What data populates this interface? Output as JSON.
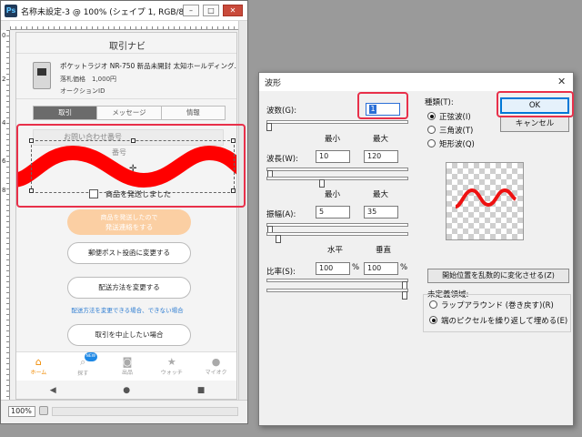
{
  "doc_window": {
    "title": "名称未設定-3 @ 100% (シェイプ 1, RGB/8)",
    "app_icon": "Ps",
    "minimize_icon": "minimize-icon",
    "maximize_icon": "maximize-icon",
    "close_icon": "close-icon",
    "ruler_v_numbers": [
      "0",
      "2",
      "4",
      "6",
      "8"
    ],
    "zoom": "100%"
  },
  "app": {
    "nav_title": "取引ナビ",
    "product": {
      "title": "ポケットラジオ NR-750 新品未開封 太知ホールディング...",
      "price": "落札価格　1,000円",
      "type": "オークションID"
    },
    "tabs": [
      {
        "label": "取引",
        "active": true
      },
      {
        "label": "メッセージ",
        "active": false
      },
      {
        "label": "情報",
        "active": false
      }
    ],
    "tracking": {
      "label": "お問い合わせ番号",
      "label2": "番号"
    },
    "shipped_checkbox_label": "商品を発送しました",
    "notice_button": {
      "line1": "商品を発送したので",
      "line2": "発送連絡をする"
    },
    "buttons": {
      "post": "郵便ポスト投函に変更する",
      "change_ship": "配送方法を変更する",
      "cancel_trade": "取引を中止したい場合"
    },
    "ship_note": "配送方法を変更できる場合、できない場合",
    "tabbar": [
      {
        "label": "ホーム",
        "icon": "home-icon",
        "glyph": "⌂",
        "active": true
      },
      {
        "label": "探す",
        "icon": "search-icon",
        "glyph": "⌕",
        "active": false,
        "badge": "NEW"
      },
      {
        "label": "出品",
        "icon": "camera-icon",
        "glyph": "◙",
        "active": false
      },
      {
        "label": "ウォッチ",
        "icon": "star-icon",
        "glyph": "★",
        "active": false
      },
      {
        "label": "マイオク",
        "icon": "person-icon",
        "glyph": "●",
        "active": false
      }
    ],
    "sysbar": {
      "back": "◀",
      "home": "●",
      "recent": "■"
    },
    "wave_color": "#ff0000"
  },
  "dialog": {
    "title": "波形",
    "close_glyph": "✕",
    "generators_label": "波数(G):",
    "generators_value": "1",
    "min_label": "最小",
    "max_label": "最大",
    "wavelength": {
      "label": "波長(W):",
      "min": "10",
      "max": "120"
    },
    "amplitude": {
      "label": "振幅(A):",
      "min": "5",
      "max": "35"
    },
    "horiz_label": "水平",
    "vert_label": "垂直",
    "scale": {
      "label": "比率(S):",
      "h": "100",
      "v": "100",
      "unit": "%"
    },
    "type_label": "種類(T):",
    "types": [
      {
        "label": "正弦波(I)",
        "selected": true
      },
      {
        "label": "三角波(T)",
        "selected": false
      },
      {
        "label": "矩形波(Q)",
        "selected": false
      }
    ],
    "ok_label": "OK",
    "cancel_label": "キャンセル",
    "random_label": "開始位置を乱数的に変化させる(Z)",
    "undef_label": "未定義領域:",
    "undef_options": [
      {
        "label": "ラップアラウンド (巻き戻す)(R)",
        "selected": false
      },
      {
        "label": "端のピクセルを繰り返して埋める(E)",
        "selected": true
      }
    ],
    "preview_wave_color": "#ee1111"
  },
  "highlight_color": "#e8304a"
}
